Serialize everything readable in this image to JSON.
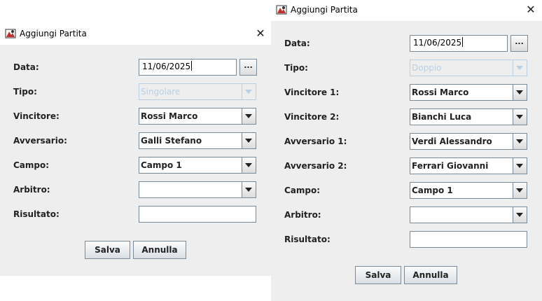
{
  "dialog_single": {
    "title": "Aggiungi Partita",
    "close_glyph": "✕",
    "icon": "app-icon",
    "labels": {
      "data": "Data:",
      "tipo": "Tipo:",
      "vincitore": "Vincitore:",
      "avversario": "Avversario:",
      "campo": "Campo:",
      "arbitro": "Arbitro:",
      "risultato": "Risultato:"
    },
    "values": {
      "data": "11/06/2025",
      "tipo": "Singolare",
      "vincitore": "Rossi Marco",
      "avversario": "Galli Stefano",
      "campo": "Campo 1",
      "arbitro": "",
      "risultato": ""
    },
    "browse_label": "...",
    "save_label": "Salva",
    "cancel_label": "Annulla"
  },
  "dialog_double": {
    "title": "Aggiungi Partita",
    "close_glyph": "✕",
    "icon": "app-icon",
    "labels": {
      "data": "Data:",
      "tipo": "Tipo:",
      "vincitore1": "Vincitore 1:",
      "vincitore2": "Vincitore 2:",
      "avversario1": "Avversario 1:",
      "avversario2": "Avversario 2:",
      "campo": "Campo:",
      "arbitro": "Arbitro:",
      "risultato": "Risultato:"
    },
    "values": {
      "data": "11/06/2025",
      "tipo": "Doppio",
      "vincitore1": "Rossi Marco",
      "vincitore2": "Bianchi Luca",
      "avversario1": "Verdi Alessandro",
      "avversario2": "Ferrari Giovanni",
      "campo": "Campo 1",
      "arbitro": "",
      "risultato": ""
    },
    "browse_label": "...",
    "save_label": "Salva",
    "cancel_label": "Annulla"
  }
}
